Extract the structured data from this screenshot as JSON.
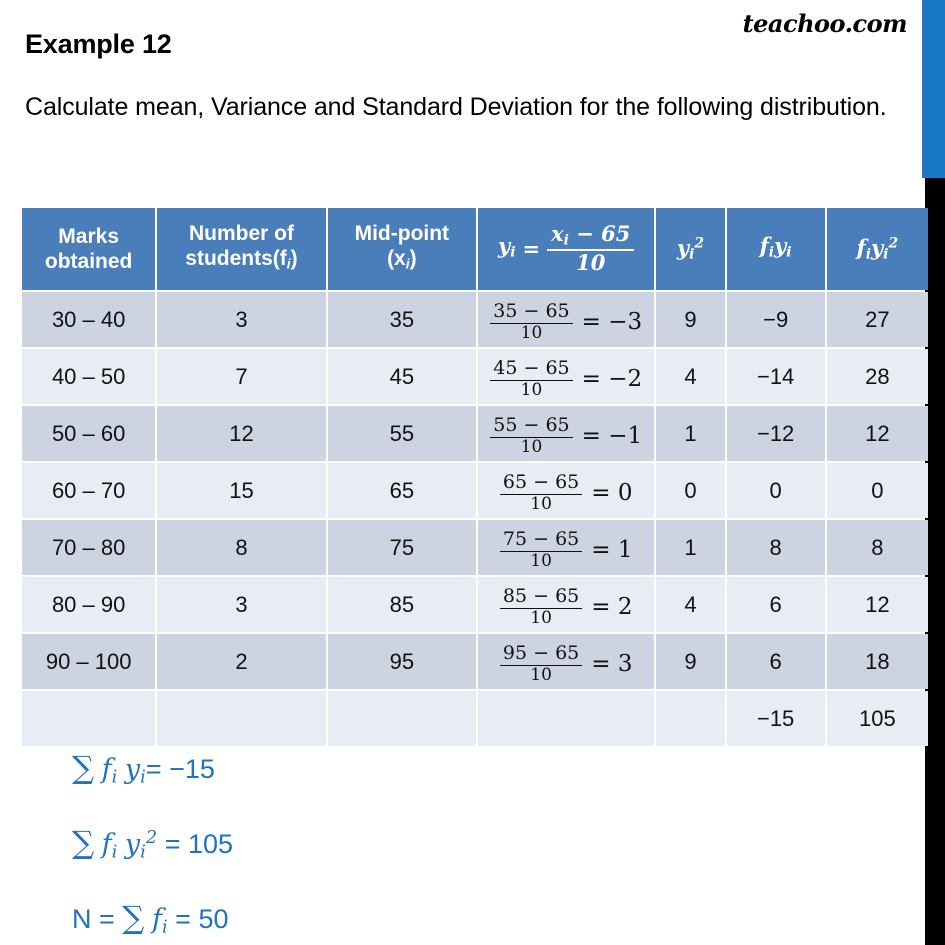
{
  "brand": "teachoo.com",
  "page_title": "Example 12",
  "prompt": "Calculate mean, Variance and Standard Deviation for the following distribution.",
  "colors": {
    "header_blue": "#4a7ebb",
    "row_dark": "#ced3e2",
    "row_light": "#e8ecf5",
    "accent_blue": "#1f72c4",
    "edge_blue": "#1878c8",
    "edge_black": "#000000"
  },
  "table": {
    "headers": {
      "marks_line1": "Marks",
      "marks_line2": "obtained",
      "students_line1": "Number of",
      "students_line2": "students(f",
      "students_sub": "i",
      "students_line2_end": ")",
      "mid_line1": "Mid-point",
      "mid_line2_open": "(x",
      "mid_sub": "i",
      "mid_line2_close": ")",
      "formula_var": "y",
      "formula_var_sub": "i",
      "formula_eq": "=",
      "formula_num_var": "x",
      "formula_num_sub": "i",
      "formula_num_rest": "− 65",
      "formula_den": "10",
      "ysq_var": "y",
      "ysq_sub": "i",
      "ysq_sup": "2",
      "fy_f": "f",
      "fy_f_sub": "i",
      "fy_y": "y",
      "fy_y_sub": "i",
      "fysq_f": "f",
      "fysq_f_sub": "i",
      "fysq_y": "y",
      "fysq_y_sub": "i",
      "fysq_sup": "2"
    },
    "rows": [
      {
        "marks": "30 – 40",
        "students": "3",
        "mid": "35",
        "frac_num": "35 − 65",
        "frac_den": "10",
        "frac_eq": "= −3",
        "ysq": "9",
        "fy": "−9",
        "fysq": "27"
      },
      {
        "marks": "40 – 50",
        "students": "7",
        "mid": "45",
        "frac_num": "45 − 65",
        "frac_den": "10",
        "frac_eq": "= −2",
        "ysq": "4",
        "fy": "−14",
        "fysq": "28"
      },
      {
        "marks": "50 – 60",
        "students": "12",
        "mid": "55",
        "frac_num": "55 − 65",
        "frac_den": "10",
        "frac_eq": "= −1",
        "ysq": "1",
        "fy": "−12",
        "fysq": "12"
      },
      {
        "marks": "60 – 70",
        "students": "15",
        "mid": "65",
        "frac_num": "65 − 65",
        "frac_den": "10",
        "frac_eq": "= 0",
        "ysq": "0",
        "fy": "0",
        "fysq": "0"
      },
      {
        "marks": "70 – 80",
        "students": "8",
        "mid": "75",
        "frac_num": "75 − 65",
        "frac_den": "10",
        "frac_eq": "= 1",
        "ysq": "1",
        "fy": "8",
        "fysq": "8"
      },
      {
        "marks": "80 – 90",
        "students": "3",
        "mid": "85",
        "frac_num": "85 − 65",
        "frac_den": "10",
        "frac_eq": "= 2",
        "ysq": "4",
        "fy": "6",
        "fysq": "12"
      },
      {
        "marks": "90 – 100",
        "students": "2",
        "mid": "95",
        "frac_num": "95 − 65",
        "frac_den": "10",
        "frac_eq": "= 3",
        "ysq": "9",
        "fy": "6",
        "fysq": "18"
      }
    ],
    "total_row": {
      "marks": "",
      "students": "",
      "mid": "",
      "formula": "",
      "ysq": "",
      "fy": "−15",
      "fysq": "105"
    }
  },
  "summary": {
    "line1": {
      "sigma": "∑",
      "f": "f",
      "f_sub": "i",
      "y": "y",
      "y_sub": "i",
      "eq": "= −15"
    },
    "line2": {
      "sigma": "∑",
      "f": "f",
      "f_sub": "i",
      "y": "y",
      "y_sub": "i",
      "sup": "2",
      "eq": "= 105"
    },
    "line3": {
      "n": "N =",
      "sigma": "∑",
      "f": "f",
      "f_sub": "i",
      "eq": "= 50"
    }
  }
}
